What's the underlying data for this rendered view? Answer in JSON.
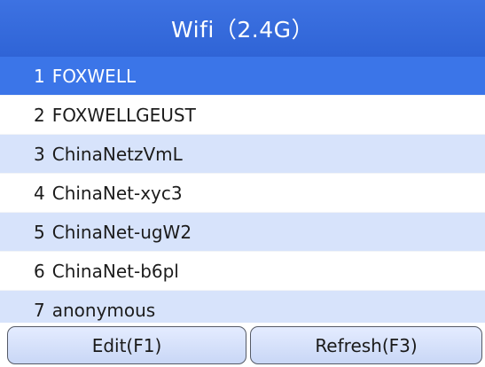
{
  "header": {
    "title": "Wifi（2.4G）"
  },
  "networks": [
    {
      "index": "1",
      "name": "FOXWELL"
    },
    {
      "index": "2",
      "name": "FOXWELLGEUST"
    },
    {
      "index": "3",
      "name": "ChinaNetzVmL"
    },
    {
      "index": "4",
      "name": "ChinaNet-xyc3"
    },
    {
      "index": "5",
      "name": "ChinaNet-ugW2"
    },
    {
      "index": "6",
      "name": "ChinaNet-b6pl"
    },
    {
      "index": "7",
      "name": "anonymous"
    }
  ],
  "footer": {
    "edit_label": "Edit(F1)",
    "refresh_label": "Refresh(F3)"
  },
  "colors": {
    "header": "#3167d8",
    "selected_row": "#3b75e8",
    "alt_row": "#d7e3fb",
    "button_fill": "#d3defa"
  }
}
